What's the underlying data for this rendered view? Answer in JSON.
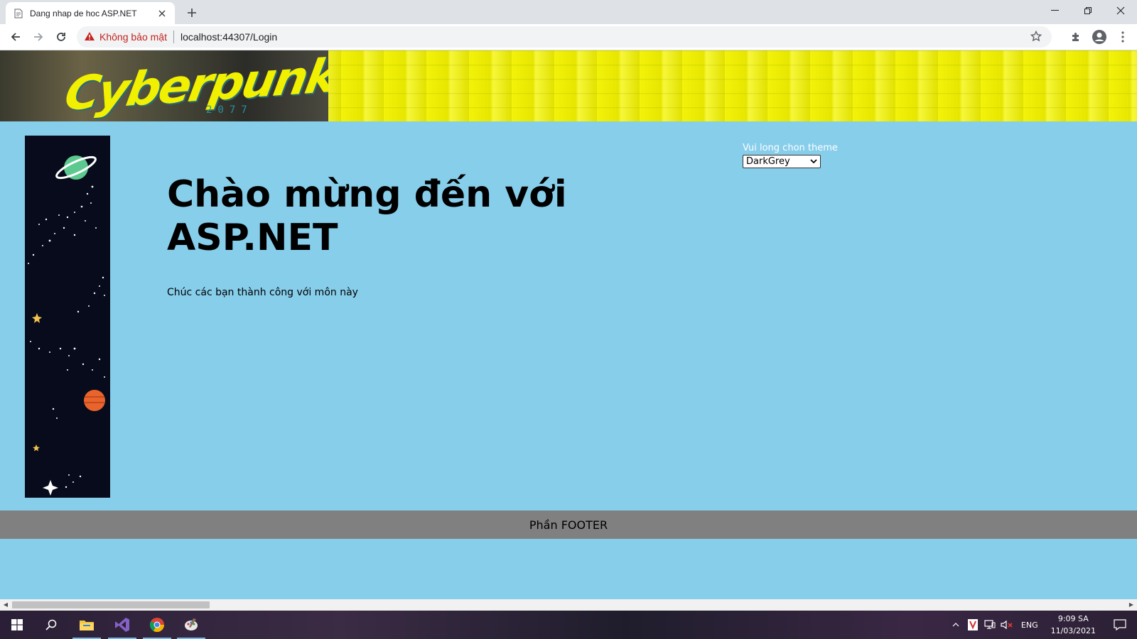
{
  "browser": {
    "tab_title": "Dang nhap de hoc ASP.NET",
    "security_text": "Không bảo mật",
    "url": "localhost:44307/Login"
  },
  "page": {
    "theme_label": "Vui long chon theme",
    "theme_selected": "DarkGrey",
    "welcome_line1": "Chào mừng đến với",
    "welcome_line2": "ASP.NET",
    "subtitle": "Chúc các bạn thành công với môn này",
    "footer": "Phần FOOTER"
  },
  "taskbar": {
    "language": "ENG",
    "time": "9:09 SA",
    "date": "11/03/2021"
  },
  "colors": {
    "page_bg": "#87ceeb",
    "footer_bg": "#808080",
    "banner_yellow": "#f0f000"
  }
}
